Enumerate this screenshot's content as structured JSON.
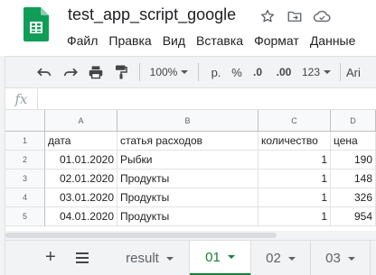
{
  "document": {
    "title": "test_app_script_google"
  },
  "title_icons": [
    "star-icon",
    "move-to-folder-icon",
    "cloud-status-icon"
  ],
  "menu": [
    "Файл",
    "Правка",
    "Вид",
    "Вставка",
    "Формат",
    "Данные"
  ],
  "toolbar": {
    "zoom": "100%",
    "currency": "р.",
    "percent": "%",
    "decimals_decrease": ".0",
    "decimals_increase": ".00",
    "more_formats": "123",
    "font": "Ari"
  },
  "formula_bar": {
    "fx_label": "fx",
    "value": ""
  },
  "grid": {
    "columns": [
      "A",
      "B",
      "C",
      "D"
    ],
    "rows": [
      {
        "num": "1",
        "cells": [
          "дата",
          "статья расходов",
          "количество",
          "цена"
        ]
      },
      {
        "num": "2",
        "cells": [
          "01.01.2020",
          "Рыбки",
          "1",
          "190"
        ]
      },
      {
        "num": "3",
        "cells": [
          "02.01.2020",
          "Продукты",
          "1",
          "148"
        ]
      },
      {
        "num": "4",
        "cells": [
          "03.01.2020",
          "Продукты",
          "1",
          "326"
        ]
      },
      {
        "num": "5",
        "cells": [
          "04.01.2020",
          "Продукты",
          "1",
          "954"
        ]
      }
    ]
  },
  "sheet_tabs": {
    "tabs": [
      {
        "label": "result",
        "active": false
      },
      {
        "label": "01",
        "active": true
      },
      {
        "label": "02",
        "active": false
      },
      {
        "label": "03",
        "active": false
      }
    ]
  },
  "colors": {
    "accent": "#188038",
    "logo": "#0f9d58"
  }
}
